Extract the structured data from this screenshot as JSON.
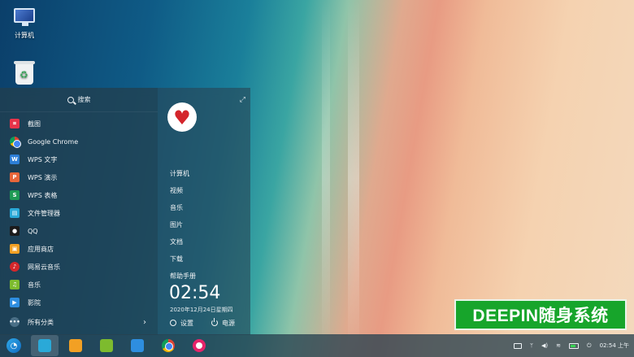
{
  "desktop": {
    "icons": [
      {
        "label": "计算机",
        "icon": "computer-icon"
      },
      {
        "label": "",
        "icon": "trash-icon"
      }
    ]
  },
  "launcher": {
    "search_placeholder": "搜索",
    "apps": [
      {
        "label": "截图",
        "icon": "screenshot-icon",
        "color": "#e8344a"
      },
      {
        "label": "Google Chrome",
        "icon": "chrome-icon",
        "color": "#4285f4"
      },
      {
        "label": "WPS 文字",
        "icon": "wps-writer-icon",
        "color": "#2d7fd8"
      },
      {
        "label": "WPS 演示",
        "icon": "wps-presentation-icon",
        "color": "#e8663a"
      },
      {
        "label": "WPS 表格",
        "icon": "wps-spreadsheet-icon",
        "color": "#1f9a55"
      },
      {
        "label": "文件管理器",
        "icon": "file-manager-icon",
        "color": "#2aa9d8"
      },
      {
        "label": "QQ",
        "icon": "qq-icon",
        "color": "#1b1b1b"
      },
      {
        "label": "应用商店",
        "icon": "app-store-icon",
        "color": "#f2a024"
      },
      {
        "label": "网易云音乐",
        "icon": "netease-music-icon",
        "color": "#d4272b"
      },
      {
        "label": "音乐",
        "icon": "music-icon",
        "color": "#7dbb2e"
      },
      {
        "label": "影院",
        "icon": "movie-icon",
        "color": "#2e8ee0"
      }
    ],
    "all_categories": "所有分类",
    "shortcuts": [
      "计算机",
      "视频",
      "音乐",
      "图片",
      "文档",
      "下载",
      "帮助手册"
    ],
    "time": "02:54",
    "date": "2020年12月24日星期四",
    "settings_label": "设置",
    "power_label": "电源"
  },
  "taskbar": {
    "apps": [
      {
        "name": "launcher",
        "icon": "launcher-icon"
      },
      {
        "name": "file-manager",
        "icon": "file-manager-icon",
        "active": true
      },
      {
        "name": "app-store",
        "icon": "app-store-icon"
      },
      {
        "name": "music",
        "icon": "music-icon"
      },
      {
        "name": "movie",
        "icon": "movie-icon"
      },
      {
        "name": "chrome",
        "icon": "chrome-icon"
      },
      {
        "name": "settings",
        "icon": "settings-icon"
      }
    ],
    "clock": "02:54 上午"
  },
  "watermark": "DEEPIN随身系统"
}
